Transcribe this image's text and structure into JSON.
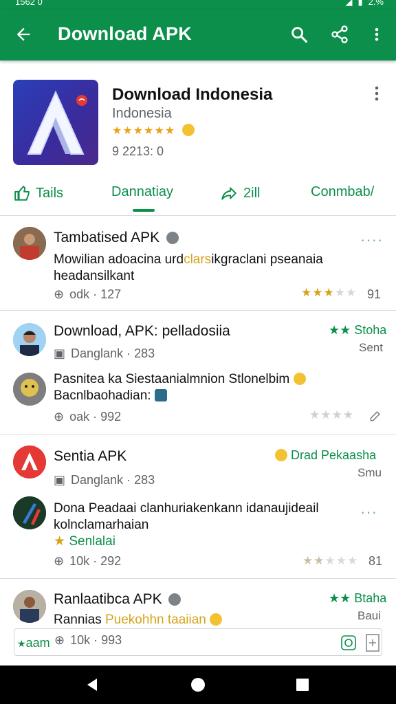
{
  "status": {
    "time": "1562 0",
    "battery": "2.%"
  },
  "appbar": {
    "title": "Download APK"
  },
  "app": {
    "name": "Download Indonesia",
    "developer": "Indonesia",
    "rating_stars": "★★★★★★",
    "count": "9 2213: 0"
  },
  "tabs": [
    {
      "label": "Tails"
    },
    {
      "label": "Dannatiay"
    },
    {
      "label": "2ill"
    },
    {
      "label": "Conmbab/"
    }
  ],
  "reviews": [
    {
      "title": "Tambatised APK",
      "text_line1_a": "Mowilian adoacina urd",
      "text_line1_b": "clars",
      "text_line1_c": "ikgraclani pseanaia",
      "text_line2": "headansilkant",
      "meta": "odk  ·  127",
      "stars_filled": "★★★",
      "stars_empty": "★★",
      "count": "91"
    },
    {
      "title": "Download, APK: pelladosiia",
      "badge": "★★ Stoha",
      "badge_sub": "Sent",
      "meta_top": "Danglank  ·  283",
      "text_line1": "Pasnitea ka Siestaanialmnion Stlonelbim",
      "text_line2": "Bacnlbaohadian:",
      "meta": "oak  ·  992",
      "stars_empty": "★★★★"
    },
    {
      "title": "Sentia APK",
      "badge": "Drad Pekaasha",
      "badge_sub": "Smu",
      "meta_top": "Danglank  ·  283",
      "text_line1": "Dona Peadaai clanhuriakenkann idanaujideail",
      "text_line2": "kolnclamarhaian",
      "highlight": "Senlalai",
      "meta": "10k  ·  292",
      "stars_filled": "★★",
      "stars_empty": "★★★",
      "count": "81"
    },
    {
      "title": "Ranlaatibca APK",
      "badge": "★★ Btaha",
      "badge_sub": "Baui",
      "text_line1_a": "Rannias",
      "text_line1_b": "Puekohhn taaiian",
      "meta": "10k  ·  993",
      "input_hint": "aam"
    }
  ],
  "colors": {
    "brand": "#0c8f4a",
    "star": "#d6a41a",
    "accent_red": "#e53935"
  }
}
